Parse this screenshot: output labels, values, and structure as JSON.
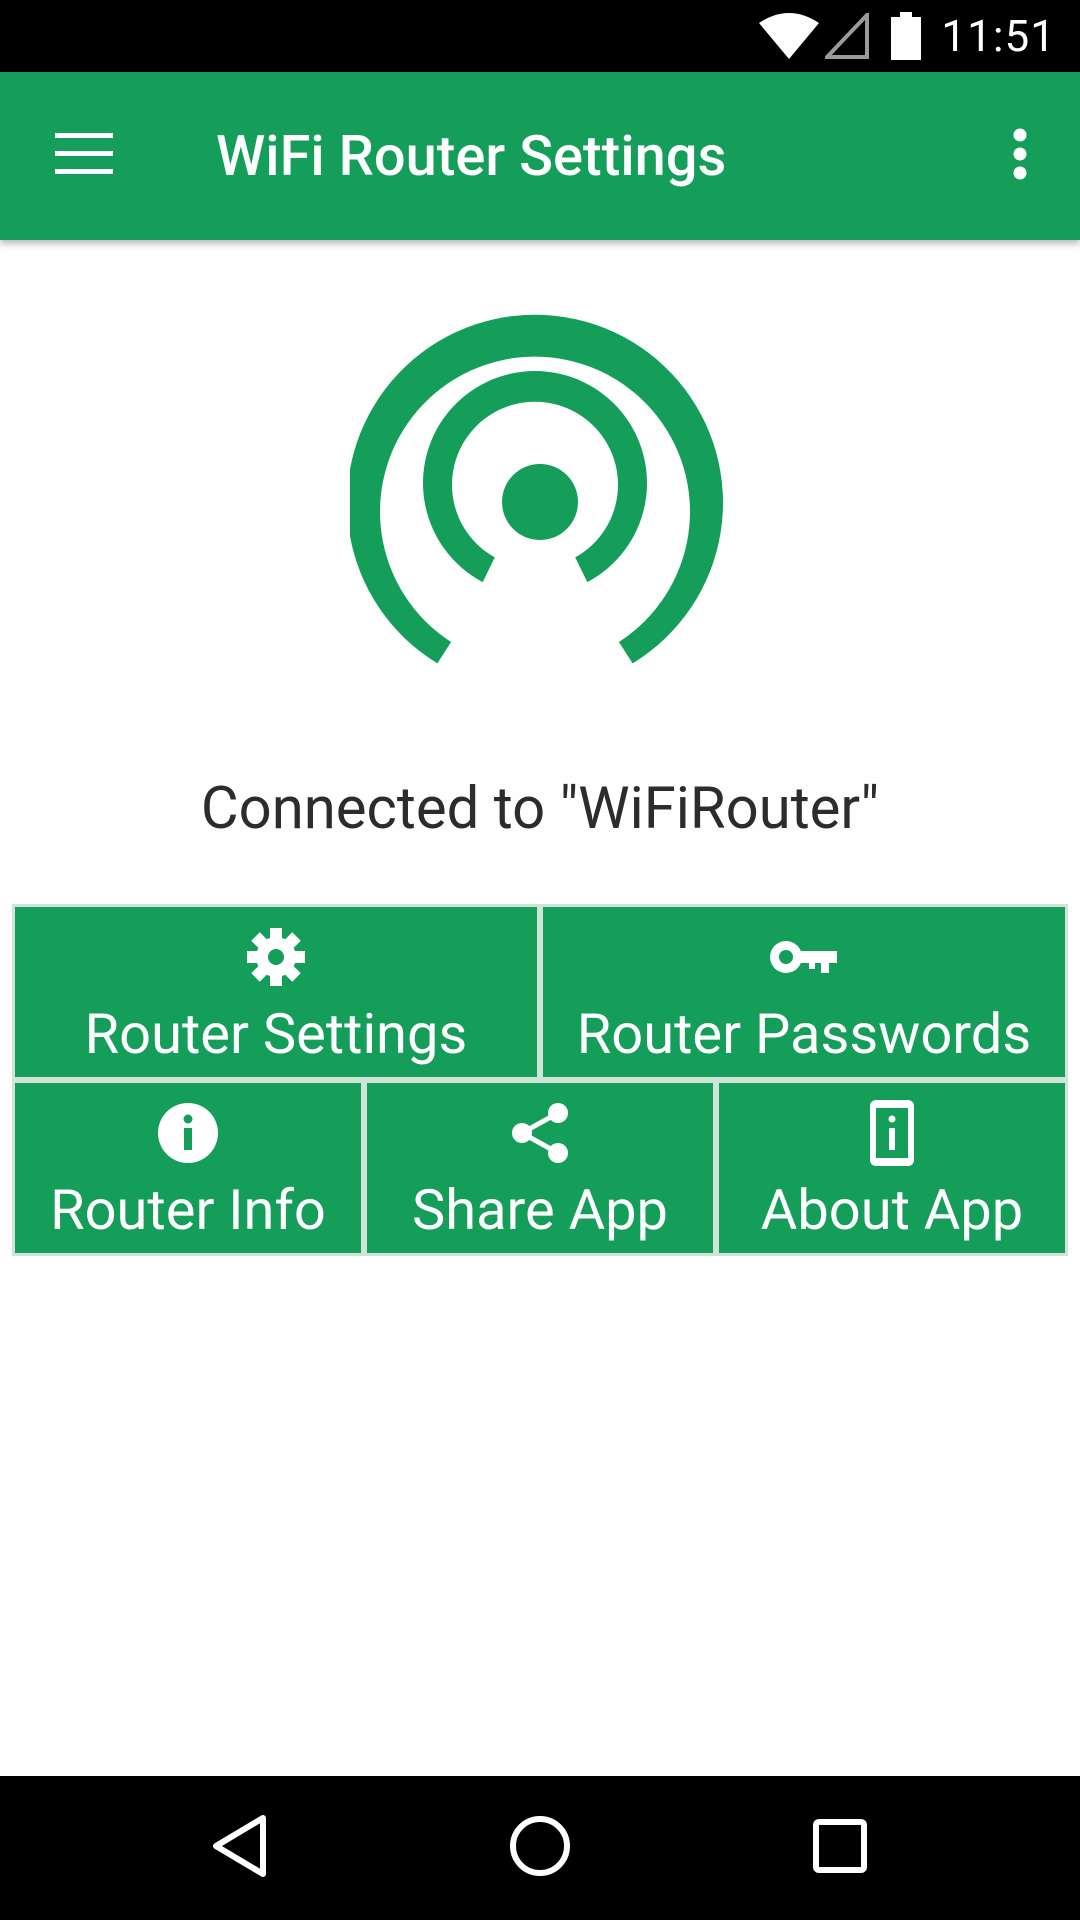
{
  "status_bar": {
    "time": "11:51",
    "icons": [
      "wifi-icon",
      "cell-signal-icon",
      "battery-icon"
    ]
  },
  "app_bar": {
    "title": "WiFi Router Settings",
    "menu_icon": "hamburger-menu-icon",
    "overflow_icon": "more-vertical-icon"
  },
  "hero": {
    "logo_icon": "wireless-signal-icon",
    "status_text": "Connected to \"WiFiRouter\""
  },
  "tiles": [
    {
      "label": "Router Settings",
      "icon": "gear-icon"
    },
    {
      "label": "Router Passwords",
      "icon": "key-icon"
    },
    {
      "label": "Router Info",
      "icon": "info-icon"
    },
    {
      "label": "Share App",
      "icon": "share-icon"
    },
    {
      "label": "About App",
      "icon": "phone-info-icon"
    }
  ],
  "nav_bar": {
    "buttons": [
      "back-icon",
      "home-icon",
      "recents-icon"
    ]
  },
  "colors": {
    "primary": "#149e59",
    "status_bar": "#000000",
    "background": "#fefefe",
    "text": "#2c2c2c"
  }
}
